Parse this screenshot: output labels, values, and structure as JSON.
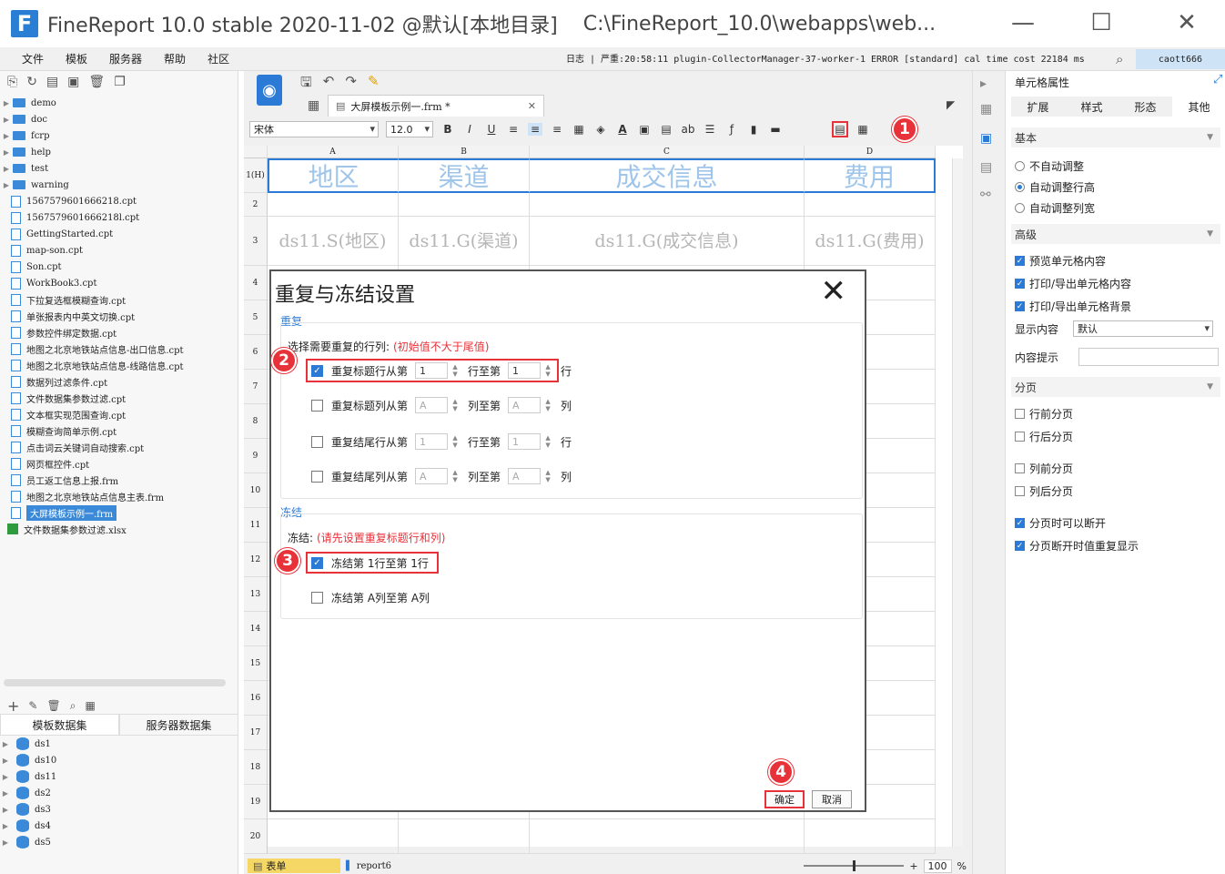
{
  "window": {
    "title": "FineReport 10.0 stable 2020-11-02 @默认[本地目录]",
    "path": "C:\\FineReport_10.0\\webapps\\web...",
    "logo": "F"
  },
  "menu": [
    "文件",
    "模板",
    "服务器",
    "帮助",
    "社区"
  ],
  "log": "日志 | 严重:20:58:11 plugin-CollectorManager-37-worker-1 ERROR [standard] cal time cost 22184 ms",
  "user": "caott666",
  "tree": [
    {
      "label": "demo",
      "type": "folder"
    },
    {
      "label": "doc",
      "type": "folder"
    },
    {
      "label": "fcrp",
      "type": "folder"
    },
    {
      "label": "help",
      "type": "folder"
    },
    {
      "label": "test",
      "type": "folder"
    },
    {
      "label": "warning",
      "type": "folder"
    },
    {
      "label": "1567579601666218.cpt",
      "type": "file"
    },
    {
      "label": "1567579601666218l.cpt",
      "type": "file"
    },
    {
      "label": "GettingStarted.cpt",
      "type": "file"
    },
    {
      "label": "map-son.cpt",
      "type": "file"
    },
    {
      "label": "Son.cpt",
      "type": "file"
    },
    {
      "label": "WorkBook3.cpt",
      "type": "file"
    },
    {
      "label": "下拉复选框模糊查询.cpt",
      "type": "file"
    },
    {
      "label": "单张报表内中英文切换.cpt",
      "type": "file"
    },
    {
      "label": "参数控件绑定数据.cpt",
      "type": "file"
    },
    {
      "label": "地图之北京地铁站点信息-出口信息.cpt",
      "type": "file"
    },
    {
      "label": "地图之北京地铁站点信息-线路信息.cpt",
      "type": "file"
    },
    {
      "label": "数据列过滤条件.cpt",
      "type": "file"
    },
    {
      "label": "文件数据集参数过滤.cpt",
      "type": "file"
    },
    {
      "label": "文本框实现范围查询.cpt",
      "type": "file"
    },
    {
      "label": "模糊查询简单示例.cpt",
      "type": "file"
    },
    {
      "label": "点击词云关键词自动搜索.cpt",
      "type": "file"
    },
    {
      "label": "网页框控件.cpt",
      "type": "file"
    },
    {
      "label": "员工返工信息上报.frm",
      "type": "file"
    },
    {
      "label": "地图之北京地铁站点信息主表.frm",
      "type": "file"
    },
    {
      "label": "大屏模板示例一.frm",
      "type": "file",
      "selected": true
    },
    {
      "label": "文件数据集参数过滤.xlsx",
      "type": "xlsx"
    }
  ],
  "datasets": {
    "tabs": [
      "模板数据集",
      "服务器数据集"
    ],
    "items": [
      "ds1",
      "ds10",
      "ds11",
      "ds2",
      "ds3",
      "ds4",
      "ds5"
    ]
  },
  "editor": {
    "doc_tab": "大屏模板示例一.frm *",
    "font": "宋体",
    "size": "12.0",
    "columns": [
      "A",
      "B",
      "C",
      "D"
    ],
    "rows": [
      "1(H)",
      "2",
      "3",
      "4",
      "5",
      "6",
      "7",
      "8",
      "9",
      "10",
      "11",
      "12",
      "13",
      "14",
      "15",
      "16",
      "17",
      "18",
      "19",
      "20"
    ],
    "header_cells": [
      "地区",
      "渠道",
      "成交信息",
      "费用"
    ],
    "data_cells": [
      "ds11.S(地区)",
      "ds11.G(渠道)",
      "ds11.G(成交信息)",
      "ds11.G(费用)"
    ]
  },
  "dialog": {
    "title": "重复与冻结设置",
    "repeat_label": "重复",
    "repeat_hint": "选择需要重复的行列:",
    "repeat_warn": "(初始值不大于尾值)",
    "rows": [
      {
        "label": "重复标题行从第",
        "from": "1",
        "mid": "行至第",
        "to": "1",
        "unit": "行",
        "checked": true
      },
      {
        "label": "重复标题列从第",
        "from": "A",
        "mid": "列至第",
        "to": "A",
        "unit": "列",
        "checked": false
      },
      {
        "label": "重复结尾行从第",
        "from": "1",
        "mid": "行至第",
        "to": "1",
        "unit": "行",
        "checked": false
      },
      {
        "label": "重复结尾列从第",
        "from": "A",
        "mid": "列至第",
        "to": "A",
        "unit": "列",
        "checked": false
      }
    ],
    "freeze_label": "冻结",
    "freeze_hint": "冻结:",
    "freeze_warn": "(请先设置重复标题行和列)",
    "freeze_row": "冻结第 1行至第  1行",
    "freeze_col": "冻结第 A列至第  A列",
    "ok": "确定",
    "cancel": "取消"
  },
  "badges": [
    "1",
    "2",
    "3",
    "4"
  ],
  "props": {
    "title": "单元格属性",
    "tabs": [
      "扩展",
      "样式",
      "形态",
      "其他"
    ],
    "basic": "基本",
    "radios": [
      {
        "label": "不自动调整",
        "on": false
      },
      {
        "label": "自动调整行高",
        "on": true
      },
      {
        "label": "自动调整列宽",
        "on": false
      }
    ],
    "advanced": "高级",
    "checks": [
      {
        "label": "预览单元格内容",
        "on": true
      },
      {
        "label": "打印/导出单元格内容",
        "on": true
      },
      {
        "label": "打印/导出单元格背景",
        "on": true
      }
    ],
    "show_content": "显示内容",
    "show_value": "默认",
    "tip": "内容提示",
    "paging": "分页",
    "paging_checks": [
      {
        "label": "行前分页",
        "on": false
      },
      {
        "label": "行后分页",
        "on": false
      },
      {
        "label": "列前分页",
        "on": false
      },
      {
        "label": "列后分页",
        "on": false
      },
      {
        "label": "分页时可以断开",
        "on": true
      },
      {
        "label": "分页断开时值重复显示",
        "on": true
      }
    ]
  },
  "status": {
    "sheet1": "表单",
    "sheet2": "report6",
    "zoom": "100",
    "pct": "%"
  }
}
